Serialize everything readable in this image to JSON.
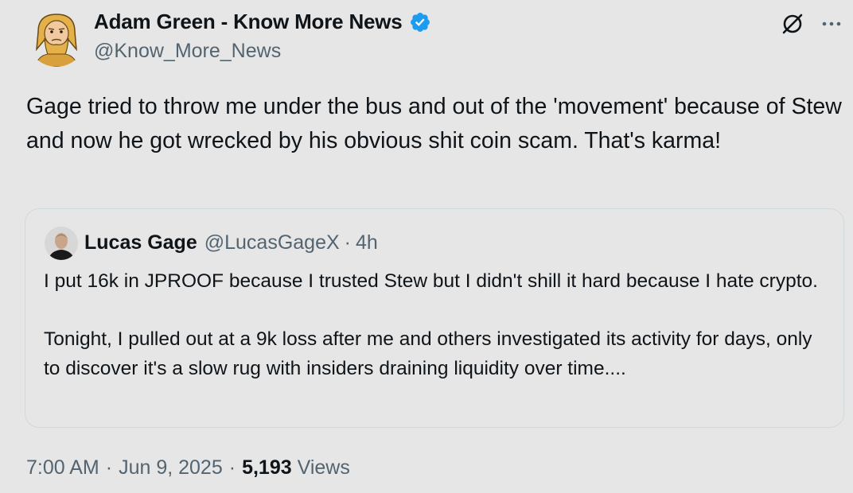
{
  "author": {
    "name": "Adam Green - Know More News",
    "handle": "@Know_More_News",
    "verified_color": "#1d9bf0"
  },
  "tweet": {
    "text": "Gage tried to throw me under the bus and out of the 'movement' because of Stew and now he got wrecked by his obvious shit coin scam. That's karma!"
  },
  "quote": {
    "name": "Lucas Gage",
    "handle": "@LucasGageX",
    "separator": "·",
    "time": "4h",
    "text": "I put 16k in JPROOF because I trusted Stew but I didn't shill it hard because I hate crypto.\n\nTonight, I pulled out at a 9k loss after me and others investigated its activity for days, only to discover it's a slow rug with insiders draining liquidity over time...."
  },
  "meta": {
    "time": "7:00 AM",
    "separator": "·",
    "date": "Jun 9, 2025",
    "views_count": "5,193",
    "views_label": "Views"
  },
  "icons": {
    "header_right": [
      "grok-icon",
      "more-icon"
    ],
    "verified": "verified-badge-icon"
  }
}
